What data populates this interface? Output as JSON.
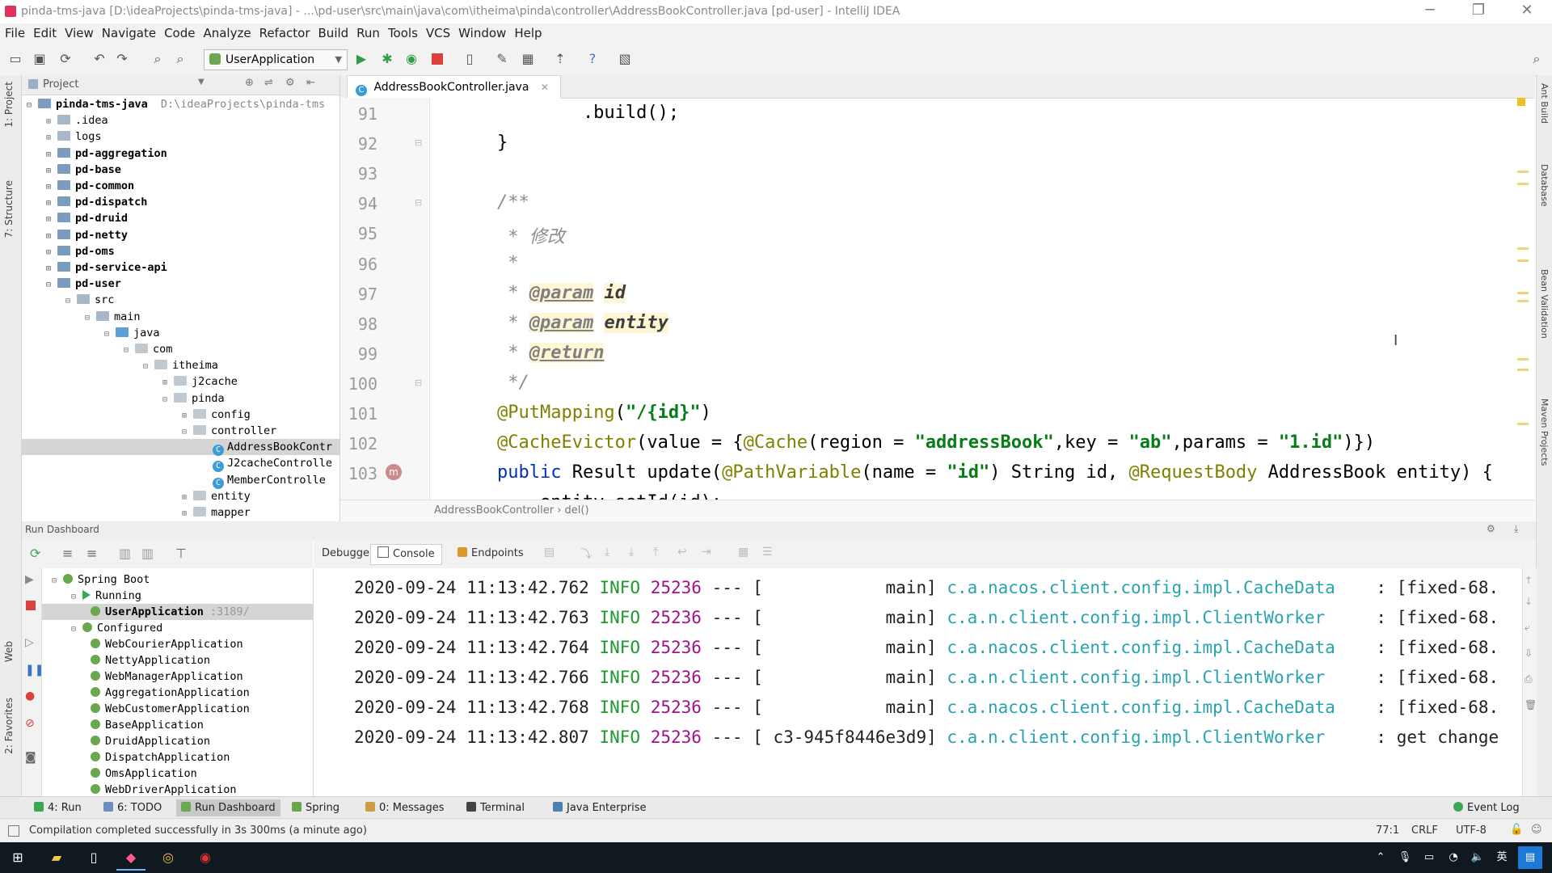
{
  "title_bar": {
    "text": "pinda-tms-java [D:\\ideaProjects\\pinda-tms-java] - ...\\pd-user\\src\\main\\java\\com\\itheima\\pinda\\controller\\AddressBookController.java [pd-user] - IntelliJ IDEA",
    "minimize": "─",
    "maximize": "❐",
    "close": "✕"
  },
  "menu": [
    "File",
    "Edit",
    "View",
    "Navigate",
    "Code",
    "Analyze",
    "Refactor",
    "Build",
    "Run",
    "Tools",
    "VCS",
    "Window",
    "Help"
  ],
  "toolbar": {
    "run_config": "UserApplication"
  },
  "left_strip": {
    "project": "1: Project",
    "structure": "7: Structure",
    "web": "Web",
    "favorites": "2: Favorites"
  },
  "project_panel": {
    "header": "Project",
    "tree": [
      {
        "label": "pinda-tms-java",
        "extra": "D:\\ideaProjects\\pinda-tms",
        "depth": 0,
        "kind": "module",
        "bold": true,
        "open": true
      },
      {
        "label": ".idea",
        "depth": 1,
        "kind": "folder"
      },
      {
        "label": "logs",
        "depth": 1,
        "kind": "folder"
      },
      {
        "label": "pd-aggregation",
        "depth": 1,
        "kind": "module",
        "bold": true
      },
      {
        "label": "pd-base",
        "depth": 1,
        "kind": "module",
        "bold": true
      },
      {
        "label": "pd-common",
        "depth": 1,
        "kind": "module",
        "bold": true
      },
      {
        "label": "pd-dispatch",
        "depth": 1,
        "kind": "module",
        "bold": true
      },
      {
        "label": "pd-druid",
        "depth": 1,
        "kind": "module",
        "bold": true
      },
      {
        "label": "pd-netty",
        "depth": 1,
        "kind": "module",
        "bold": true
      },
      {
        "label": "pd-oms",
        "depth": 1,
        "kind": "module",
        "bold": true
      },
      {
        "label": "pd-service-api",
        "depth": 1,
        "kind": "module",
        "bold": true
      },
      {
        "label": "pd-user",
        "depth": 1,
        "kind": "module",
        "bold": true,
        "open": true
      },
      {
        "label": "src",
        "depth": 2,
        "kind": "folder",
        "open": true
      },
      {
        "label": "main",
        "depth": 3,
        "kind": "folder",
        "open": true
      },
      {
        "label": "java",
        "depth": 4,
        "kind": "src",
        "open": true
      },
      {
        "label": "com",
        "depth": 5,
        "kind": "pkg",
        "open": true
      },
      {
        "label": "itheima",
        "depth": 6,
        "kind": "pkg",
        "open": true
      },
      {
        "label": "j2cache",
        "depth": 7,
        "kind": "pkg"
      },
      {
        "label": "pinda",
        "depth": 7,
        "kind": "pkg",
        "open": true
      },
      {
        "label": "config",
        "depth": 8,
        "kind": "pkg"
      },
      {
        "label": "controller",
        "depth": 8,
        "kind": "pkg",
        "open": true
      },
      {
        "label": "AddressBookContr",
        "depth": 9,
        "kind": "class",
        "selected": true
      },
      {
        "label": "J2cacheControlle",
        "depth": 9,
        "kind": "class"
      },
      {
        "label": "MemberControlle",
        "depth": 9,
        "kind": "class"
      },
      {
        "label": "entity",
        "depth": 8,
        "kind": "pkg"
      },
      {
        "label": "mapper",
        "depth": 8,
        "kind": "pkg"
      }
    ]
  },
  "editor": {
    "tab": "AddressBookController.java",
    "breadcrumb": "AddressBookController › del()",
    "lines": [
      {
        "n": "91",
        "code": "            .build();"
      },
      {
        "n": "92",
        "code": "    }"
      },
      {
        "n": "93",
        "code": ""
      },
      {
        "n": "94",
        "code": "    /**"
      },
      {
        "n": "95",
        "code": "     * 修改"
      },
      {
        "n": "96",
        "code": "     *"
      },
      {
        "n": "97",
        "code": "     * @param id"
      },
      {
        "n": "98",
        "code": "     * @param entity"
      },
      {
        "n": "99",
        "code": "     * @return"
      },
      {
        "n": "100",
        "code": "     */"
      },
      {
        "n": "101",
        "code": "    @PutMapping(\"/{id}\")"
      },
      {
        "n": "102",
        "code": "    @CacheEvictor(value = {@Cache(region = \"addressBook\",key = \"ab\",params = \"1.id\")})"
      },
      {
        "n": "103",
        "code": "    public Result update(@PathVariable(name = \"id\") String id, @RequestBody AddressBook entity) {"
      }
    ],
    "partial_line": "        entity.setId(id);"
  },
  "right_strip": [
    "Ant Build",
    "Database",
    "Bean Validation",
    "Maven Projects"
  ],
  "run_dashboard": {
    "header": "Run Dashboard",
    "tree": [
      {
        "label": "Spring Boot",
        "depth": 0
      },
      {
        "label": "Running",
        "depth": 1
      },
      {
        "label": "UserApplication",
        "extra": ":3189/",
        "depth": 2,
        "selected": true
      },
      {
        "label": "Configured",
        "depth": 1
      },
      {
        "label": "WebCourierApplication",
        "depth": 2
      },
      {
        "label": "NettyApplication",
        "depth": 2
      },
      {
        "label": "WebManagerApplication",
        "depth": 2
      },
      {
        "label": "AggregationApplication",
        "depth": 2
      },
      {
        "label": "WebCustomerApplication",
        "depth": 2
      },
      {
        "label": "BaseApplication",
        "depth": 2
      },
      {
        "label": "DruidApplication",
        "depth": 2
      },
      {
        "label": "DispatchApplication",
        "depth": 2
      },
      {
        "label": "OmsApplication",
        "depth": 2
      },
      {
        "label": "WebDriverApplication",
        "depth": 2
      }
    ],
    "tabs": [
      "Debugger",
      "Console",
      "Endpoints"
    ],
    "log": [
      {
        "ts": "2020-09-24 11:13:42.762",
        "level": "INFO",
        "pid": "25236",
        "sep": "--- [",
        "thread": "           main]",
        "logger": "c.a.nacos.client.config.impl.CacheData   ",
        "msg": " : [fixed-68."
      },
      {
        "ts": "2020-09-24 11:13:42.763",
        "level": "INFO",
        "pid": "25236",
        "sep": "--- [",
        "thread": "           main]",
        "logger": "c.a.n.client.config.impl.ClientWorker    ",
        "msg": " : [fixed-68."
      },
      {
        "ts": "2020-09-24 11:13:42.764",
        "level": "INFO",
        "pid": "25236",
        "sep": "--- [",
        "thread": "           main]",
        "logger": "c.a.nacos.client.config.impl.CacheData   ",
        "msg": " : [fixed-68."
      },
      {
        "ts": "2020-09-24 11:13:42.766",
        "level": "INFO",
        "pid": "25236",
        "sep": "--- [",
        "thread": "           main]",
        "logger": "c.a.n.client.config.impl.ClientWorker    ",
        "msg": " : [fixed-68."
      },
      {
        "ts": "2020-09-24 11:13:42.768",
        "level": "INFO",
        "pid": "25236",
        "sep": "--- [",
        "thread": "           main]",
        "logger": "c.a.nacos.client.config.impl.CacheData   ",
        "msg": " : [fixed-68."
      },
      {
        "ts": "2020-09-24 11:13:42.807",
        "level": "INFO",
        "pid": "25236",
        "sep": "--- [",
        "thread": "c3-945f8446e3d9]",
        "logger": "c.a.n.client.config.impl.ClientWorker    ",
        "msg": " : get change"
      }
    ]
  },
  "tool_tabs": [
    {
      "label": "4: Run",
      "color": "#3aa757"
    },
    {
      "label": "6: TODO",
      "color": "#6b8fb8"
    },
    {
      "label": "Run Dashboard",
      "color": "#6aa84f",
      "selected": true
    },
    {
      "label": "Spring",
      "color": "#6aa84f"
    },
    {
      "label": "0: Messages",
      "color": "#c8a040"
    },
    {
      "label": "Terminal",
      "color": "#444444"
    },
    {
      "label": "Java Enterprise",
      "color": "#5080b0"
    }
  ],
  "event_log": "Event Log",
  "status": {
    "message": "Compilation completed successfully in 3s 300ms (a minute ago)",
    "position": "77:1",
    "line_sep": "CRLF",
    "encoding": "UTF-8"
  },
  "colors": {
    "annotation": "#808000",
    "string": "#067d17",
    "keyword": "#0033b3",
    "log_level": "#1d9a2d",
    "log_pid": "#a0118a",
    "log_logger": "#28a3b0"
  }
}
